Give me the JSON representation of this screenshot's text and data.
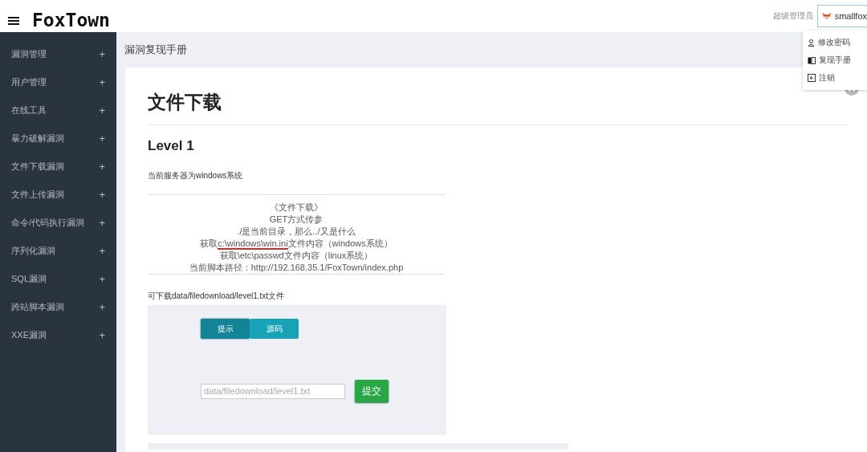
{
  "header": {
    "logo": "FoxTown",
    "role": "超级管理员",
    "user": "smallfox",
    "user_menu": [
      {
        "kind": "person",
        "label": "修改密码"
      },
      {
        "kind": "book",
        "label": "复现手册"
      },
      {
        "kind": "logout",
        "label": "注销"
      }
    ]
  },
  "sidebar": {
    "items": [
      {
        "label": "漏洞管理",
        "toggle": "+"
      },
      {
        "label": "用户管理",
        "toggle": "+"
      },
      {
        "label": "在线工具",
        "toggle": "+"
      },
      {
        "label": "暴力破解漏洞",
        "toggle": "+"
      },
      {
        "label": "文件下载漏洞",
        "toggle": "+"
      },
      {
        "label": "文件上传漏洞",
        "toggle": "+"
      },
      {
        "label": "命令/代码执行漏洞",
        "toggle": "+"
      },
      {
        "label": "序列化漏洞",
        "toggle": "+"
      },
      {
        "label": "SQL漏洞",
        "toggle": "+"
      },
      {
        "label": "跨站脚本漏洞",
        "toggle": "+"
      },
      {
        "label": "XXE漏洞",
        "toggle": "+"
      }
    ]
  },
  "breadcrumb": "漏洞复现手册",
  "content": {
    "title": "文件下载",
    "level": "Level 1",
    "server_note": "当前服务器为windows系统",
    "notes": [
      {
        "parts": [
          "《文件下载》"
        ]
      },
      {
        "parts": [
          "GET方式传参"
        ]
      },
      {
        "parts": [
          "./是当前目录，那么../又是什么"
        ]
      },
      {
        "parts": [
          "获取",
          {
            "text": "c:\\windows\\win.ini",
            "underlined": true
          },
          "文件内容（windows系统）"
        ]
      },
      {
        "parts": [
          "获取\\etc\\passwd文件内容（linux系统）"
        ]
      },
      {
        "parts": [
          "当前脚本路径：http://192.168.35.1/FoxTown/index.php"
        ]
      }
    ],
    "download_note": "可下载data/filedownload/level1.txt文件",
    "tabs": [
      {
        "label": "提示",
        "selected": true
      },
      {
        "label": "源码",
        "selected": false
      }
    ],
    "file_field": {
      "placeholder": "data/filedownload/level1.txt"
    },
    "submit": "提交"
  }
}
